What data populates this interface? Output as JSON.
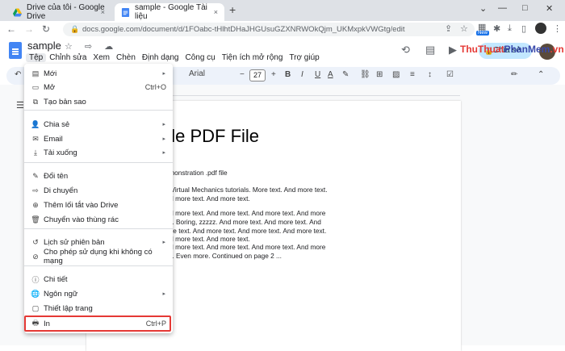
{
  "browser": {
    "tabs": [
      {
        "title": "Drive của tôi - Google Drive",
        "close": "×"
      },
      {
        "title": "sample - Google Tài liệu",
        "close": "×"
      }
    ],
    "new_tab": "+",
    "window_controls": [
      "⌄",
      "—",
      "□",
      "✕"
    ],
    "url": "docs.google.com/document/d/1FOabc-tHlhtDHaJHGUsuGZXNRWOkQjm_UKMxpkVWGtg/edit",
    "ext_badge": "New"
  },
  "doc": {
    "title": "sample",
    "menus": [
      "Tệp",
      "Chỉnh sửa",
      "Xem",
      "Chèn",
      "Định dạng",
      "Công cụ",
      "Tiện ích mở rộng",
      "Trợ giúp"
    ],
    "share_label": "Chia sẻ"
  },
  "toolbar": {
    "font": "Arial",
    "size": "27"
  },
  "file_menu": {
    "items": [
      {
        "icon": "▤",
        "label": "Mới",
        "shortcut": "",
        "arrow": "▸"
      },
      {
        "icon": "▭",
        "label": "Mở",
        "shortcut": "Ctrl+O",
        "arrow": ""
      },
      {
        "icon": "⧉",
        "label": "Tạo bản sao",
        "shortcut": "",
        "arrow": ""
      },
      {
        "icon": "👤",
        "label": "Chia sẻ",
        "shortcut": "",
        "arrow": "▸"
      },
      {
        "icon": "✉",
        "label": "Email",
        "shortcut": "",
        "arrow": "▸"
      },
      {
        "icon": "⤓",
        "label": "Tải xuống",
        "shortcut": "",
        "arrow": "▸"
      },
      {
        "icon": "✎",
        "label": "Đổi tên",
        "shortcut": "",
        "arrow": ""
      },
      {
        "icon": "⇨",
        "label": "Di chuyển",
        "shortcut": "",
        "arrow": ""
      },
      {
        "icon": "⊕",
        "label": "Thêm lối tắt vào Drive",
        "shortcut": "",
        "arrow": ""
      },
      {
        "icon": "🗑",
        "label": "Chuyển vào thùng rác",
        "shortcut": "",
        "arrow": ""
      },
      {
        "icon": "↺",
        "label": "Lịch sử phiên bản",
        "shortcut": "",
        "arrow": "▸"
      },
      {
        "icon": "⊘",
        "label": "Cho phép sử dụng khi không có mạng",
        "shortcut": "",
        "arrow": ""
      },
      {
        "icon": "ⓘ",
        "label": "Chi tiết",
        "shortcut": "",
        "arrow": ""
      },
      {
        "icon": "🌐",
        "label": "Ngôn ngữ",
        "shortcut": "",
        "arrow": "▸"
      },
      {
        "icon": "▢",
        "label": "Thiết lập trang",
        "shortcut": "",
        "arrow": ""
      },
      {
        "icon": "🖶",
        "label": "In",
        "shortcut": "Ctrl+P",
        "arrow": ""
      }
    ]
  },
  "content": {
    "heading": "ple PDF File",
    "p1": "demonstration .pdf file",
    "p2": "he Virtual Mechanics tutorials. More text. And more text. And more text. And more text.",
    "p3": "And more text. And more text. And more text. And more text. Boring, zzzzz. And more text. And more text. And more text. And more text. And more text. And more text. And more text. And more text.",
    "p3b": "And more text.",
    "p4": "And more text. And more text. And more text. And more text. Even more. Continued on page 2 ..."
  },
  "watermark": {
    "a": "ThuThuat",
    "b": "PhanMem",
    "c": ".vn"
  }
}
